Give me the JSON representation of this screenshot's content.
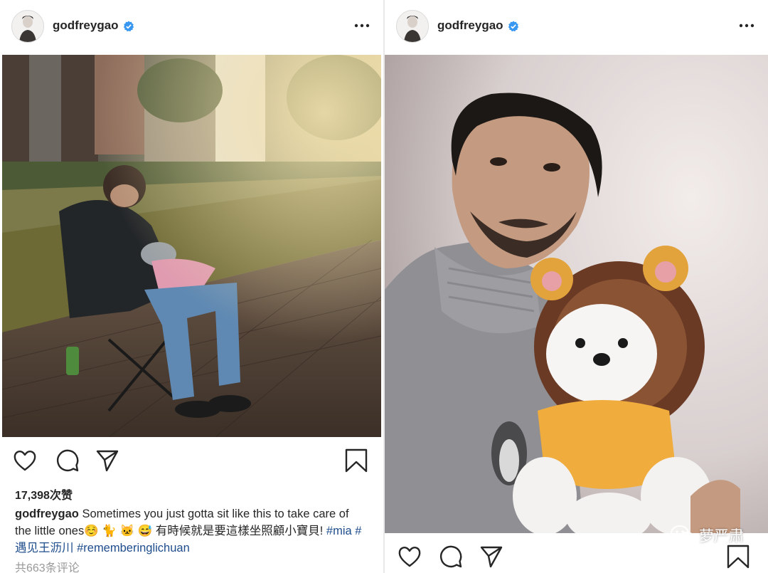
{
  "colors": {
    "text": "#262626",
    "verified": "#3897f0",
    "hashtag": "#1e4d8c",
    "muted": "#999999"
  },
  "left_post": {
    "username": "godfreygao",
    "verified_icon": "verified-badge-icon",
    "more_icon": "more-options-icon",
    "photo_description": "man in a winter jacket sitting on a folding chair on a sidewalk, holding a grey cat wrapped in a pink towel",
    "actions": [
      "heart-icon",
      "comment-icon",
      "share-icon",
      "bookmark-icon"
    ],
    "likes": "17,398次赞",
    "caption": {
      "user": "godfreygao",
      "text": "Sometimes you just gotta sit like this to take care of the little ones☺️ 🐈 🐱 😅 有時候就是要這樣坐照顧小寶貝!",
      "hashtags": [
        "#mia",
        "#遇见王沥川",
        "#rememberinglichuan"
      ]
    },
    "comments": "共663条评论"
  },
  "right_post": {
    "username": "godfreygao",
    "verified_icon": "verified-badge-icon",
    "more_icon": "more-options-icon",
    "photo_description": "selfie of a man in a grey turtleneck holding a white pomeranian dressed in a lion costume",
    "actions": [
      "heart-icon",
      "comment-icon",
      "share-icon",
      "bookmark-icon"
    ]
  },
  "watermark": {
    "icon": "wechat-icon",
    "text": "萝严肃"
  }
}
